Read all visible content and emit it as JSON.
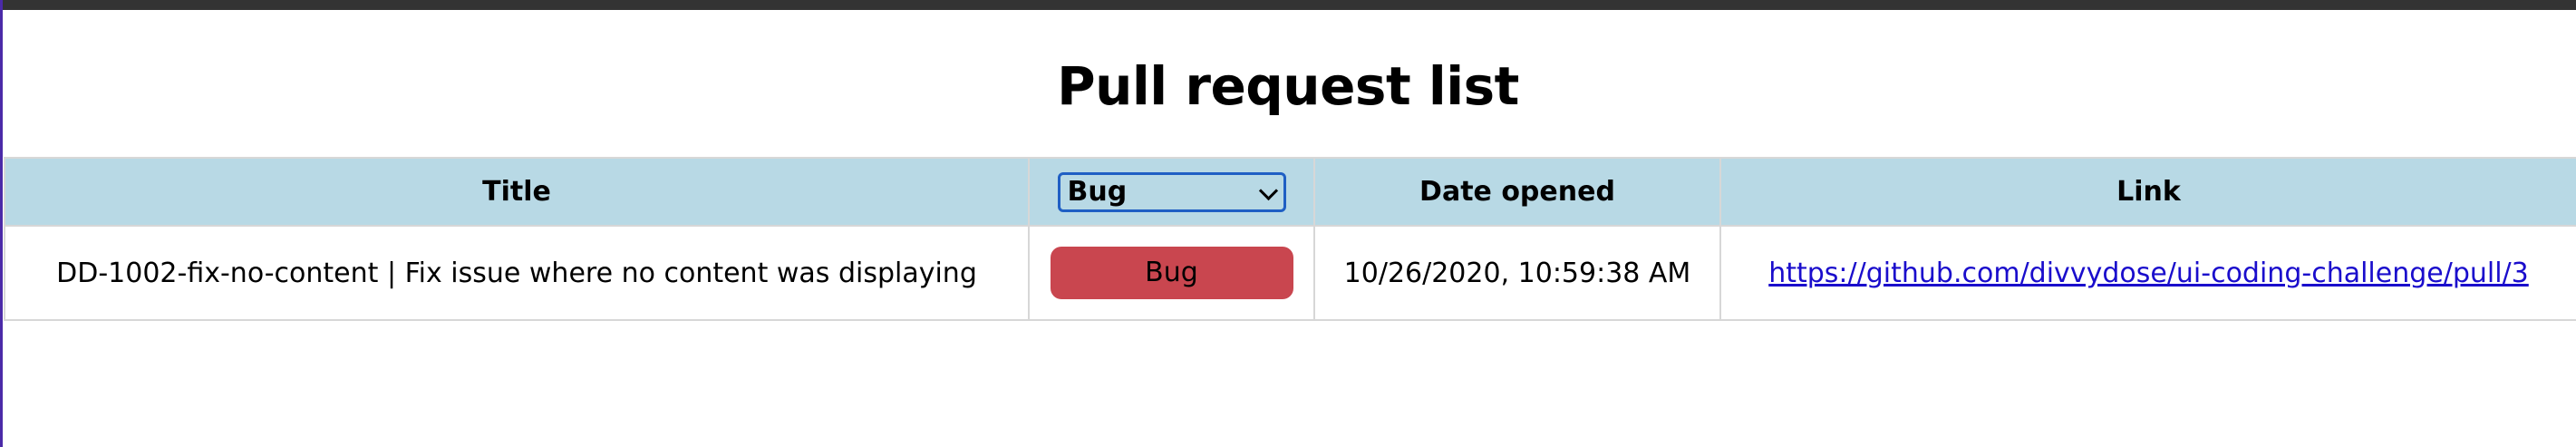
{
  "page": {
    "title": "Pull request list"
  },
  "colors": {
    "header_bg": "#b8d9e5",
    "bug_badge": "#c9464f",
    "link": "#1a0dcc",
    "top_bar": "#333333"
  },
  "table": {
    "columns": {
      "title": "Title",
      "label_filter": {
        "selected": "Bug",
        "options": [
          "Bug"
        ]
      },
      "date_opened": "Date opened",
      "link": "Link"
    },
    "rows": [
      {
        "title": "DD-1002-fix-no-content | Fix issue where no content was displaying",
        "label": "Bug",
        "date_opened": "10/26/2020, 10:59:38 AM",
        "link": "https://github.com/divvydose/ui-coding-challenge/pull/3"
      }
    ]
  }
}
